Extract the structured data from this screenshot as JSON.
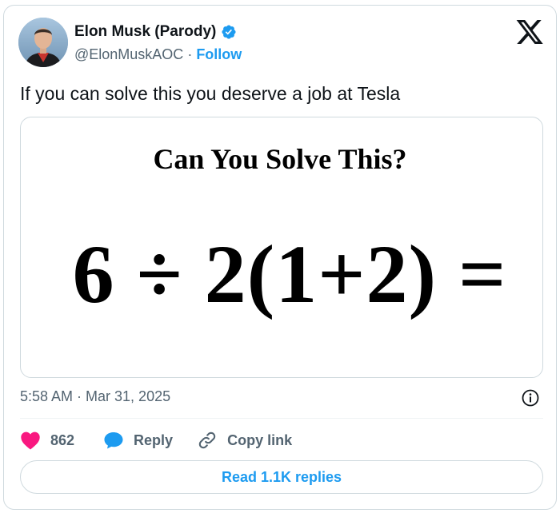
{
  "author": {
    "display_name": "Elon Musk (Parody)",
    "handle": "@ElonMuskAOC",
    "separator": "·",
    "follow_label": "Follow"
  },
  "tweet": {
    "text": "If you can solve this you deserve a job at Tesla",
    "timestamp": "5:58 AM · Mar 31, 2025"
  },
  "media": {
    "title": "Can You Solve This?",
    "equation": "6 ÷ 2(1+2) ="
  },
  "actions": {
    "like_count": "862",
    "reply_label": "Reply",
    "copy_link_label": "Copy link"
  },
  "footer": {
    "read_replies_label": "Read 1.1K replies"
  },
  "colors": {
    "accent": "#1d9bf0",
    "like": "#f91880",
    "text": "#0f1419",
    "muted": "#536471",
    "border": "#cfd9de"
  },
  "icons": {
    "verified": "verified-badge-icon",
    "brand": "x-logo-icon",
    "info": "info-icon",
    "like": "heart-icon",
    "reply": "reply-bubble-icon",
    "copy_link": "link-icon"
  }
}
